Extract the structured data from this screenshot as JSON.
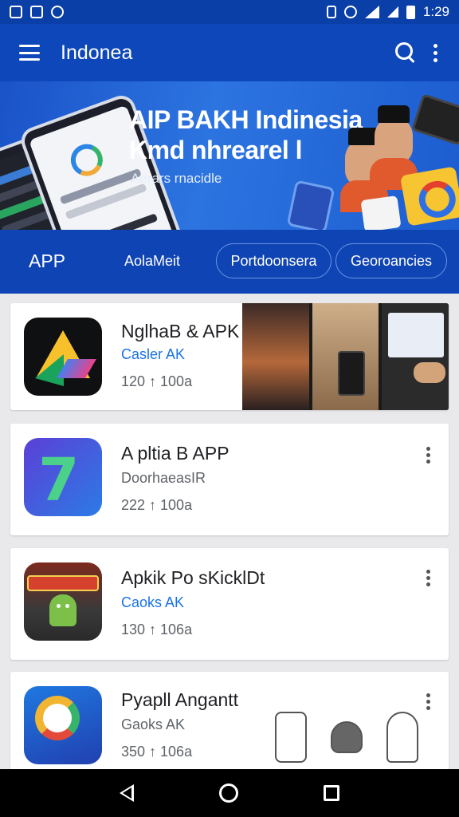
{
  "status_bar": {
    "time": "1:29"
  },
  "app_bar": {
    "title": "Indonea"
  },
  "banner": {
    "headline": "AIP BAKH Indinesia",
    "subhead": "Kmd nhrearel l",
    "caption": "Aerars rnacidle"
  },
  "chips": [
    "APP",
    "AolaMeit",
    "Portdoonsera",
    "Georoancies"
  ],
  "apps": [
    {
      "title": "NglhaB & APK",
      "subtitle": "Casler AK",
      "subtitle_color": "#1a73e8",
      "meta": "120 ↑ 100a"
    },
    {
      "title": "A pltia B APP",
      "subtitle": "DoorhaeasIR",
      "subtitle_color": "#5f6368",
      "meta": "222 ↑ 100a"
    },
    {
      "title": "Apkik Po sKicklDt",
      "subtitle": "Caoks AK",
      "subtitle_color": "#1a73e8",
      "meta": "130 ↑ 106a"
    },
    {
      "title": "Pyapll Angantt",
      "subtitle": "Gaoks AK",
      "subtitle_color": "#5f6368",
      "meta": "350 ↑ 106a"
    }
  ],
  "icons": {
    "app1": "drive-icon",
    "app2": "a-letter-icon",
    "app3": "android-icon",
    "app4": "maps-icon"
  },
  "colors": {
    "app_bar": "#0e47b9",
    "accent": "#1a73e8"
  }
}
